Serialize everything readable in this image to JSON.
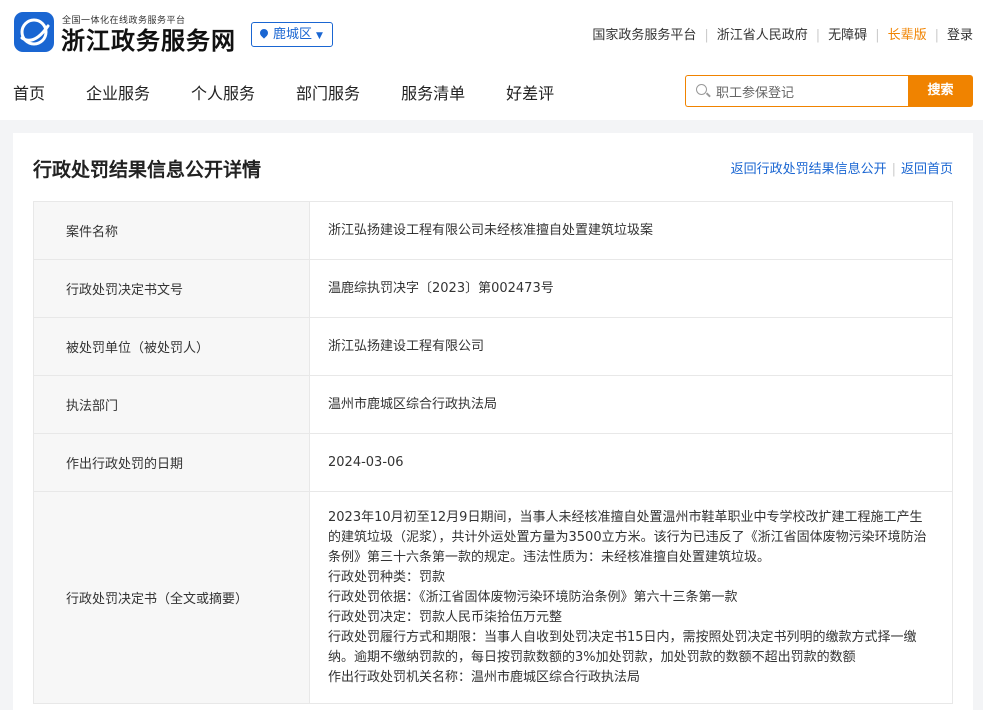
{
  "header": {
    "logo_small": "全国一体化在线政务服务平台",
    "logo_big": "浙江政务服务网",
    "region": "鹿城区",
    "top_links": [
      "国家政务服务平台",
      "浙江省人民政府",
      "无障碍",
      "长辈版",
      "登录"
    ]
  },
  "nav": [
    "首页",
    "企业服务",
    "个人服务",
    "部门服务",
    "服务清单",
    "好差评"
  ],
  "search": {
    "value": "职工参保登记",
    "button": "搜索"
  },
  "page": {
    "title": "行政处罚结果信息公开详情",
    "back_list": "返回行政处罚结果信息公开",
    "back_home": "返回首页"
  },
  "details": [
    {
      "label": "案件名称",
      "value": "浙江弘扬建设工程有限公司未经核准擅自处置建筑垃圾案"
    },
    {
      "label": "行政处罚决定书文号",
      "value": "温鹿综执罚决字〔2023〕第002473号"
    },
    {
      "label": "被处罚单位（被处罚人）",
      "value": "浙江弘扬建设工程有限公司"
    },
    {
      "label": "执法部门",
      "value": "温州市鹿城区综合行政执法局"
    },
    {
      "label": "作出行政处罚的日期",
      "value": "2024-03-06"
    }
  ],
  "decision": {
    "label": "行政处罚决定书（全文或摘要）",
    "paragraphs": [
      "2023年10月初至12月9日期间，当事人未经核准擅自处置温州市鞋革职业中专学校改扩建工程施工产生的建筑垃圾（泥浆），共计外运处置方量为3500立方米。该行为已违反了《浙江省固体废物污染环境防治条例》第三十六条第一款的规定。违法性质为：未经核准擅自处置建筑垃圾。",
      "行政处罚种类：罚款",
      "行政处罚依据：《浙江省固体废物污染环境防治条例》第六十三条第一款",
      "行政处罚决定：罚款人民币柒拾伍万元整",
      "行政处罚履行方式和期限：当事人自收到处罚决定书15日内，需按照处罚决定书列明的缴款方式择一缴纳。逾期不缴纳罚款的，每日按罚款数额的3%加处罚款，加处罚款的数额不超出罚款的数额",
      "作出行政处罚机关名称：温州市鹿城区综合行政执法局"
    ]
  }
}
